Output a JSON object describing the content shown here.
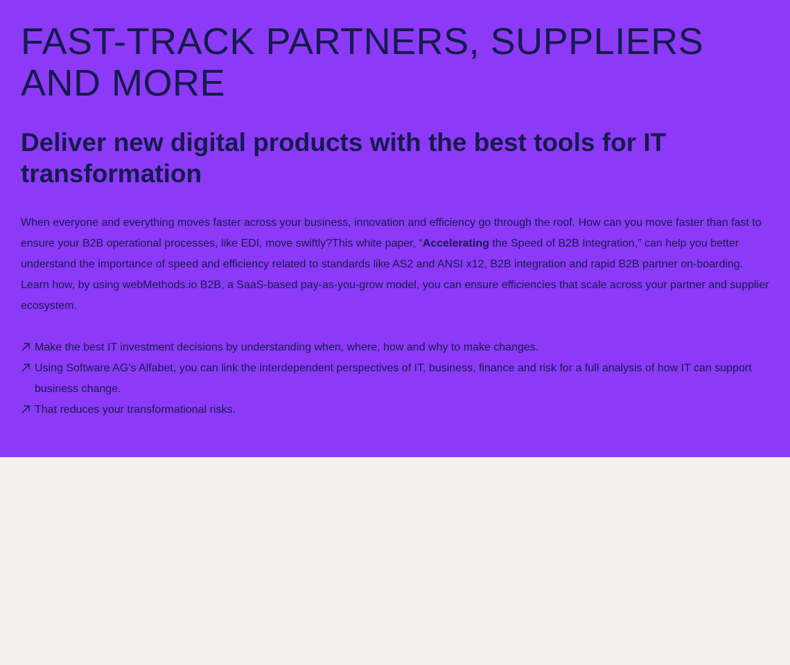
{
  "hero": {
    "eyebrow": "FAST-TRACK PARTNERS, SUPPLIERS AND MORE",
    "headline": "Deliver new digital products with the best tools for IT transformation",
    "body": {
      "part1": "When everyone and everything moves faster across your business, innovation and efficiency go through the roof. How can you move faster than fast to ensure your B2B operational processes, like EDI, move swiftly?This white paper, “",
      "bold": "Accelerating",
      "part2": " the Speed of B2B Integration,” can help you better understand the importance of speed and efficiency related to standards like AS2 and ANSI x12, B2B integration and rapid B2B partner on-boarding. Learn how, by using webMethods.io B2B, a SaaS-based pay-as-you-grow model, you can ensure efficiencies that scale across your partner and supplier ecosystem."
    },
    "bullets": [
      "Make the best IT investment decisions by understanding when, where, how and why to make changes.",
      "Using Software AG’s Alfabet, you can link the interdependent perspectives of IT, business, finance and risk for a full analysis of how IT can support business change.",
      "That reduces your transformational risks."
    ],
    "bullet_icon": "arrow-up-right-icon"
  },
  "colors": {
    "hero_background": "#8c3af7",
    "text": "#141b4d",
    "page_background": "#f2f1ea"
  }
}
